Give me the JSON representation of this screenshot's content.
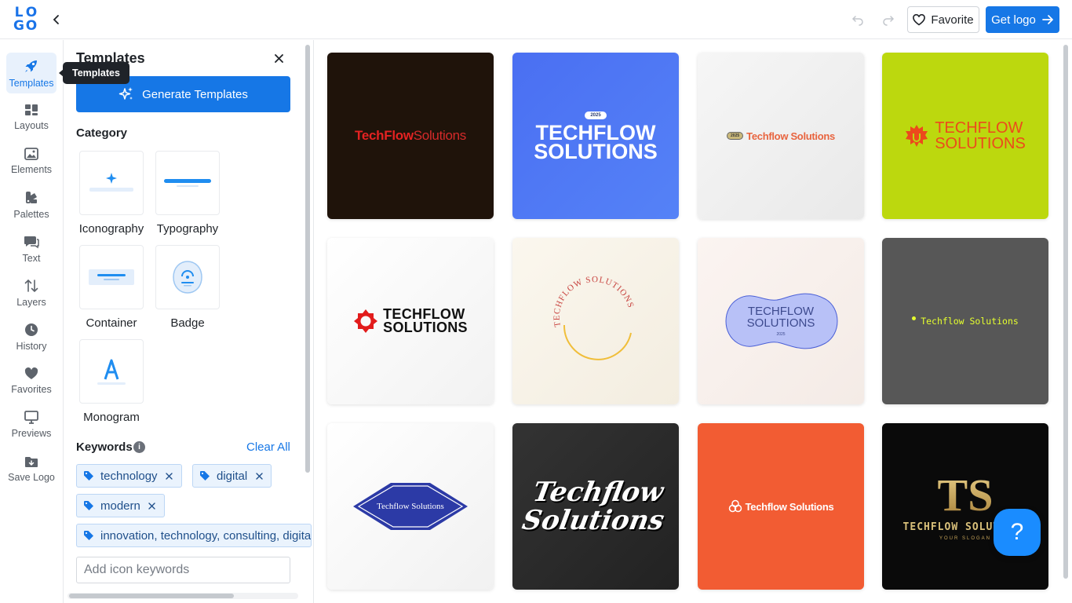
{
  "brand": {
    "logo_letters": [
      "L",
      "O",
      "G",
      "O"
    ],
    "accent": "#1677e6"
  },
  "topbar": {
    "back_icon": "chevron-left-icon",
    "undo_icon": "undo-icon",
    "redo_icon": "redo-icon",
    "favorite_label": "Favorite",
    "get_logo_label": "Get logo"
  },
  "rail": {
    "items": [
      {
        "label": "Templates",
        "icon": "rocket-icon",
        "active": true
      },
      {
        "label": "Layouts",
        "icon": "layouts-icon"
      },
      {
        "label": "Elements",
        "icon": "image-icon"
      },
      {
        "label": "Palettes",
        "icon": "palette-icon"
      },
      {
        "label": "Text",
        "icon": "text-icon"
      },
      {
        "label": "Layers",
        "icon": "layers-icon"
      },
      {
        "label": "History",
        "icon": "clock-icon"
      },
      {
        "label": "Favorites",
        "icon": "heart-icon"
      },
      {
        "label": "Previews",
        "icon": "monitor-icon"
      },
      {
        "label": "Save Logo",
        "icon": "save-folder-icon"
      }
    ],
    "tooltip": "Templates"
  },
  "panel": {
    "title": "Templates",
    "generate_label": "Generate Templates",
    "category_title": "Category",
    "categories": [
      "Iconography",
      "Typography",
      "Container",
      "Badge",
      "Monogram"
    ],
    "keywords_title": "Keywords",
    "info_glyph": "i",
    "clear_all": "Clear All",
    "keywords": [
      "technology",
      "digital",
      "modern",
      "innovation, technology, consulting, digital"
    ],
    "keyword_input_placeholder": "Add icon keywords"
  },
  "templates": [
    {
      "name": "TechFlow",
      "name2": "Solutions",
      "bg": "#1f130a"
    },
    {
      "badge": "2025",
      "line1": "TECHFLOW",
      "line2": "SOLUTIONS",
      "bg": "#4b72f4"
    },
    {
      "badge": "2025",
      "text": "Techflow Solutions",
      "bg": "#f0f0f0"
    },
    {
      "line1": "TECHFLOW",
      "line2": "SOLUTIONS",
      "bg": "#bcd80e"
    },
    {
      "line1": "TECHFLOW",
      "line2": "SOLUTIONS",
      "bg": "#fafafa"
    },
    {
      "arc": "TECHFLOW SOLUTIONS",
      "bg": "#f9f5ec"
    },
    {
      "line1": "TECHFLOW",
      "line2": "SOLUTIONS",
      "sub": "2025",
      "bg": "#f8f1ee"
    },
    {
      "text": "Techflow Solutions",
      "bg": "#575757"
    },
    {
      "text": "Techflow Solutions",
      "bg": "#fafafa"
    },
    {
      "line1": "Techflow",
      "line2": "Solutions",
      "bg": "#2a2a2a"
    },
    {
      "text": "Techflow Solutions",
      "bg": "#f25c33"
    },
    {
      "mono": "TS",
      "line1": "TECHFLOW SOLUTIONS",
      "slogan": "YOUR SLOGAN",
      "bg": "#0a0a0a"
    }
  ],
  "help": {
    "glyph": "?"
  }
}
